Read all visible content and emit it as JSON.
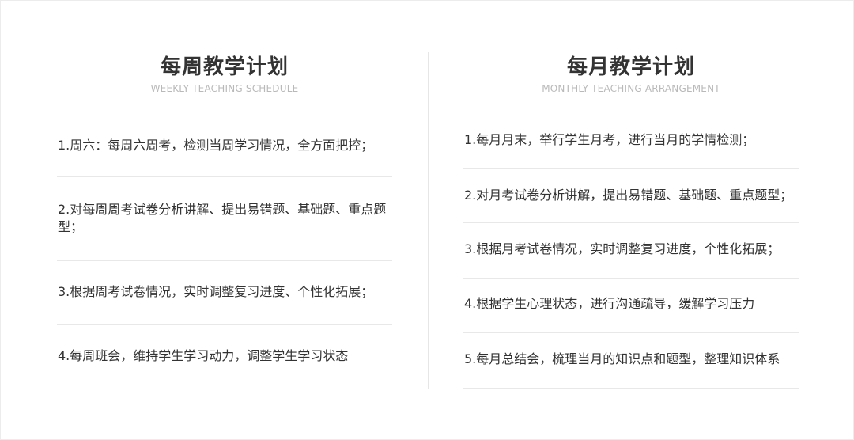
{
  "weekly": {
    "title": "每周教学计划",
    "subtitle": "WEEKLY TEACHING SCHEDULE",
    "items": [
      "1.周六：每周六周考，检测当周学习情况，全方面把控；",
      "2.对每周周考试卷分析讲解、提出易错题、基础题、重点题型；",
      "3.根据周考试卷情况，实时调整复习进度、个性化拓展；",
      "4.每周班会，维持学生学习动力，调整学生学习状态"
    ]
  },
  "monthly": {
    "title": "每月教学计划",
    "subtitle": "MONTHLY TEACHING ARRANGEMENT",
    "items": [
      "1.每月月末，举行学生月考，进行当月的学情检测；",
      "2.对月考试卷分析讲解，提出易错题、基础题、重点题型；",
      "3.根据月考试卷情况，实时调整复习进度，个性化拓展；",
      "4.根据学生心理状态，进行沟通疏导，缓解学习压力",
      "5.每月总结会，梳理当月的知识点和题型，整理知识体系"
    ]
  }
}
